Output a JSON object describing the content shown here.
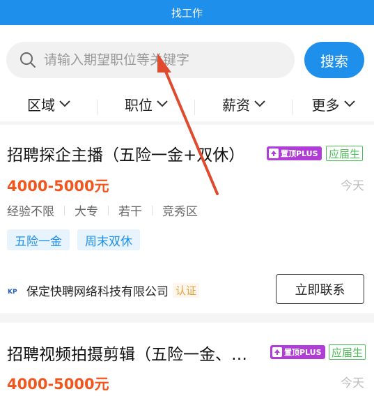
{
  "header": {
    "title": "找工作"
  },
  "search": {
    "placeholder": "请输入期望职位等关键字",
    "button_label": "搜索"
  },
  "filters": [
    {
      "label": "区域"
    },
    {
      "label": "职位"
    },
    {
      "label": "薪资"
    },
    {
      "label": "更多"
    }
  ],
  "jobs": [
    {
      "title": "招聘探企主播（五险一金+双休）",
      "top_badge": "置顶PLUS",
      "grad_badge": "应届生",
      "salary": "4000-5000元",
      "date": "今天",
      "meta": [
        "经验不限",
        "大专",
        "若干",
        "竞秀区"
      ],
      "tags": [
        "五险一金",
        "周末双休"
      ],
      "company": "保定快聘网络科技有限公司",
      "verify": "认证",
      "contact_label": "立即联系"
    },
    {
      "title": "招聘视频拍摄剪辑（五险一金、…",
      "top_badge": "置顶PLUS",
      "grad_badge": "应届生",
      "salary": "4000-5000元",
      "date": "今天"
    }
  ],
  "annotation_color": "#e04a2f"
}
